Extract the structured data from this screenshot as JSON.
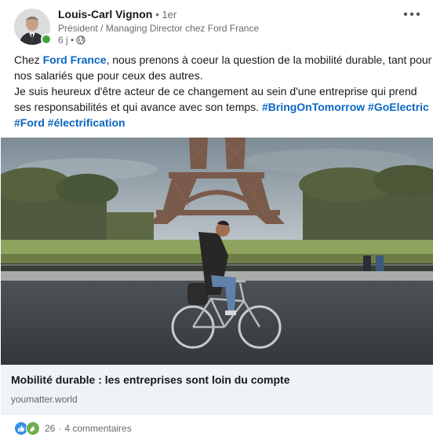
{
  "author": {
    "name": "Louis-Carl Vignon",
    "degree": "• 1er",
    "headline": "Président / Managing Director chez Ford France",
    "time": "6 j •"
  },
  "post": {
    "line1_pre": "Chez ",
    "line1_link": "Ford France",
    "line1_post": ", nous prenons à coeur la question de la mobilité durable, tant pour",
    "line2": "nos salariés que pour ceux des autres.",
    "line3": "Je suis heureux d'être acteur de ce changement au sein d'une entreprise qui prend",
    "line4_text": "ses responsabilités et qui avance avec son temps. ",
    "hashtag1": "#BringOnTomorrow",
    "hashtag2": "#GoElectric",
    "hashtag3": "#Ford",
    "hashtag4": "#électrification"
  },
  "preview": {
    "title": "Mobilité durable : les entreprises sont loin du compte",
    "domain": "youmatter.world"
  },
  "social": {
    "reactions_count": "26",
    "separator": "·",
    "comments": "4 commentaires"
  },
  "colors": {
    "link": "#0a66c2",
    "presence": "#44a340",
    "preview_bg": "#eef3f8",
    "like": "#378fe9",
    "support": "#6dae4f"
  },
  "icons": {
    "more": "ellipsis-icon",
    "visibility": "globe-icon",
    "like": "like-icon",
    "support": "support-icon"
  }
}
